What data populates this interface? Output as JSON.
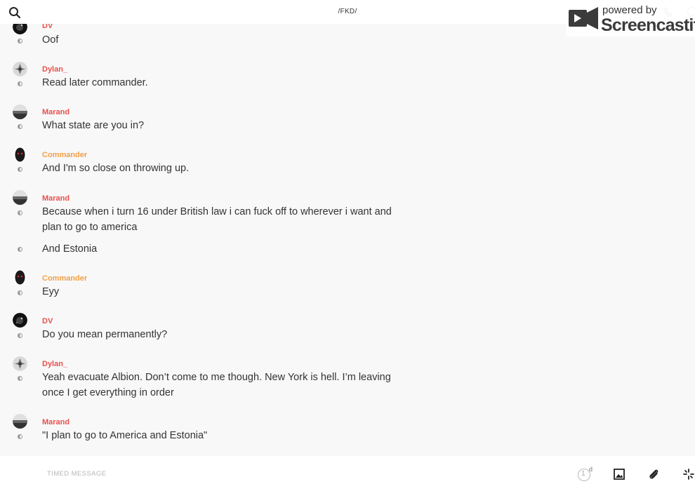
{
  "header": {
    "channel_title": "/FKD/",
    "watermark": {
      "powered_by": "powered by",
      "brand": "Screencastify"
    }
  },
  "messages": [
    {
      "author": "DV",
      "author_color": "#e8514d",
      "avatar": "dv-avatar",
      "lines": [
        "Oof"
      ]
    },
    {
      "author": "Dylan_",
      "author_color": "#e8514d",
      "avatar": "dylan-avatar",
      "lines": [
        "Read later commander."
      ]
    },
    {
      "author": "Marand",
      "author_color": "#e8514d",
      "avatar": "marand-avatar",
      "lines": [
        "What state are you in?"
      ]
    },
    {
      "author": "Commander",
      "author_color": "#f1a04a",
      "avatar": "commander-avatar",
      "lines": [
        "And I'm so close on throwing up."
      ]
    },
    {
      "author": "Marand",
      "author_color": "#e8514d",
      "avatar": "marand-avatar",
      "lines": [
        "Because when i turn 16 under British law i can fuck off to wherever i want and plan to go to america",
        "And Estonia"
      ]
    },
    {
      "author": "Commander",
      "author_color": "#f1a04a",
      "avatar": "commander-avatar",
      "lines": [
        "Eyy"
      ]
    },
    {
      "author": "DV",
      "author_color": "#e8514d",
      "avatar": "dv-avatar",
      "lines": [
        "Do you mean permanently?"
      ]
    },
    {
      "author": "Dylan_",
      "author_color": "#e8514d",
      "avatar": "dylan-avatar",
      "lines": [
        "Yeah evacuate Albion. Don’t come to me though. New York is hell. I’m leaving once I get everything in order"
      ]
    },
    {
      "author": "Marand",
      "author_color": "#e8514d",
      "avatar": "marand-avatar",
      "lines": [
        "\"I plan to go to America and Estonia\""
      ]
    }
  ],
  "composer": {
    "placeholder": "TIMED MESSAGE",
    "timer_value": "1",
    "timer_unit": "d"
  },
  "icons": [
    "search-icon",
    "phone-icon",
    "info-icon",
    "image-icon",
    "paperclip-icon",
    "sparkle-icon"
  ]
}
